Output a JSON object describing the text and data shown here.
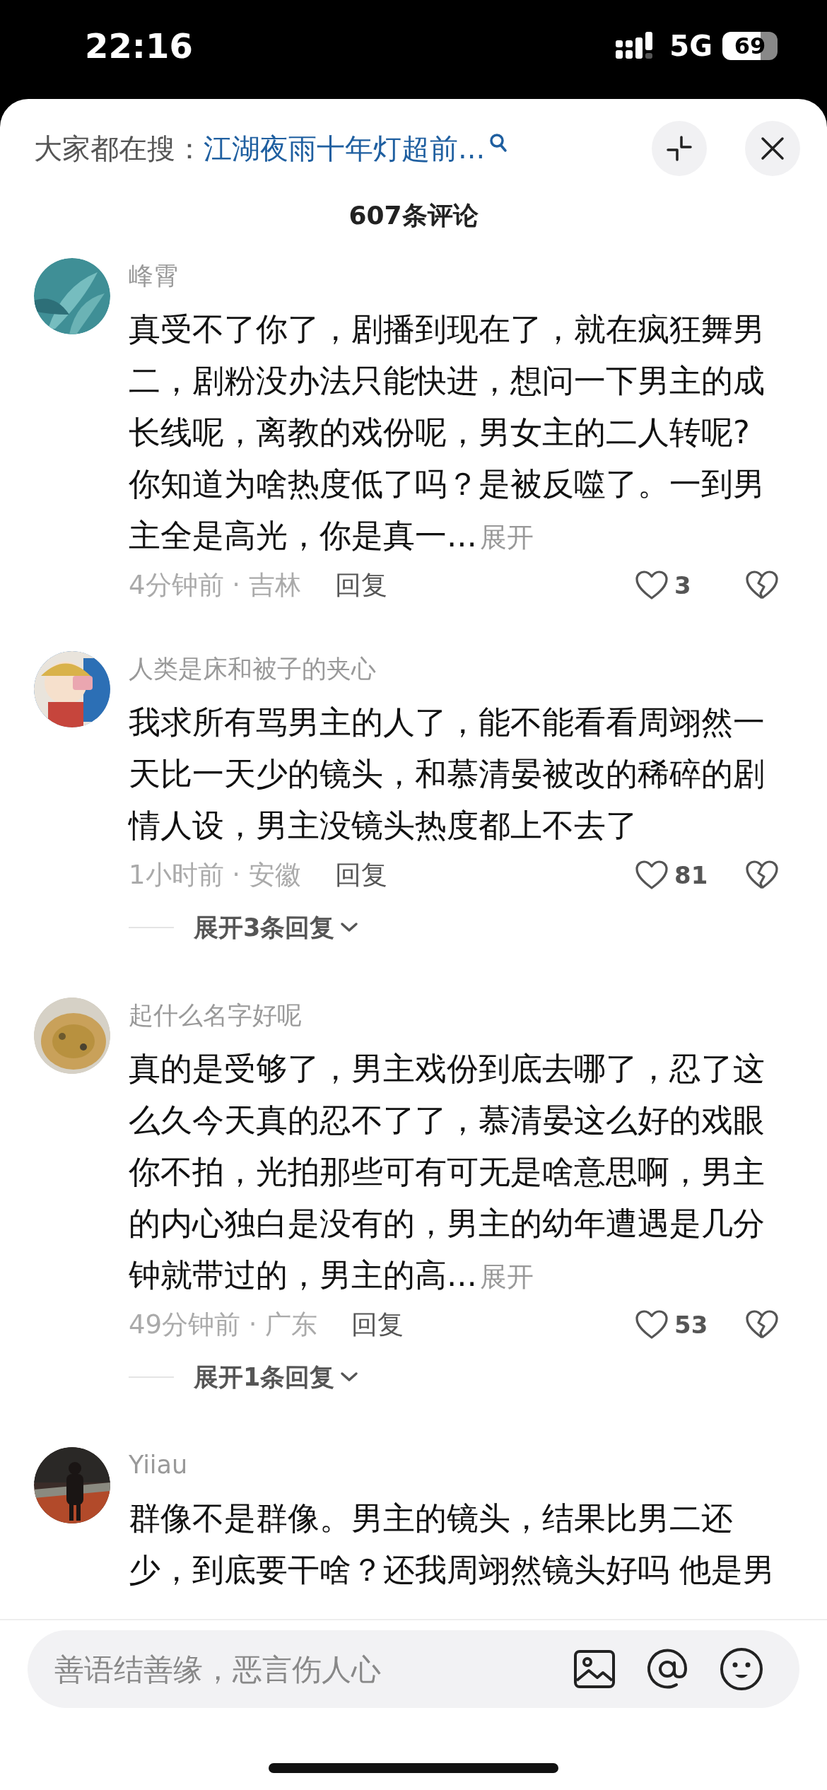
{
  "status_bar": {
    "time": "22:16",
    "network": "5G",
    "battery": "69"
  },
  "header": {
    "search_prefix": "大家都在搜：",
    "search_link": "江湖夜雨十年灯超前..."
  },
  "comment_count": "607条评论",
  "comments": [
    {
      "user": "峰霄",
      "lines": [
        "真受不了你了，剧播到现在了，就在疯狂舞男",
        "二，剧粉没办法只能快进，想问一下男主的成",
        "长线呢，离教的戏份呢，男女主的二人转呢?",
        "你知道为啥热度低了吗？是被反噬了。一到男",
        "主全是高光，你是真一..."
      ],
      "more": "展开",
      "meta": "4分钟前 · 吉林",
      "reply": "回复",
      "likes": "3"
    },
    {
      "user": "人类是床和被子的夹心",
      "lines": [
        "我求所有骂男主的人了，能不能看看周翊然一",
        "天比一天少的镜头，和慕清晏被改的稀碎的剧",
        "情人设，男主没镜头热度都上不去了"
      ],
      "meta": "1小时前 · 安徽",
      "reply": "回复",
      "likes": "81",
      "replies": "展开3条回复"
    },
    {
      "user": "起什么名字好呢",
      "lines": [
        "真的是受够了，男主戏份到底去哪了，忍了这",
        "么久今天真的忍不了了，慕清晏这么好的戏眼",
        "你不拍，光拍那些可有可无是啥意思啊，男主",
        "的内心独白是没有的，男主的幼年遭遇是几分",
        "钟就带过的，男主的高..."
      ],
      "more": "展开",
      "meta": "49分钟前 · 广东",
      "reply": "回复",
      "likes": "53",
      "replies": "展开1条回复"
    },
    {
      "user": "Yiiau",
      "lines": [
        "群像不是群像。男主的镜头，结果比男二还",
        "少，到底要干啥？还我周翊然镜头好吗 他是男"
      ]
    }
  ],
  "input": {
    "placeholder": "善语结善缘，恶言伤人心"
  }
}
